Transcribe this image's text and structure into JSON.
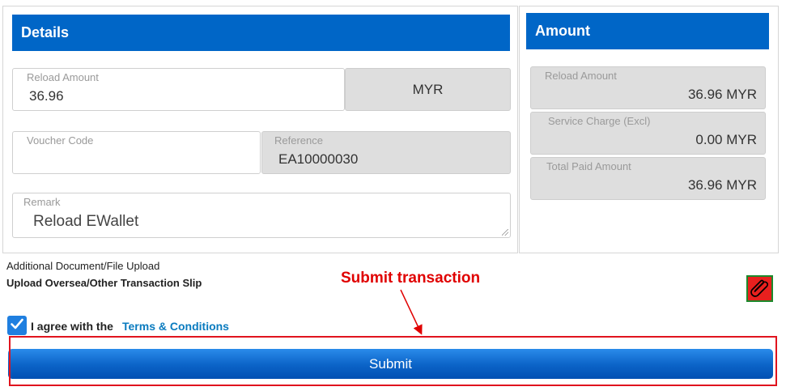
{
  "details": {
    "header": "Details",
    "reload_amount": {
      "label": "Reload Amount",
      "value": "36.96"
    },
    "currency": "MYR",
    "voucher_code": {
      "label": "Voucher Code",
      "value": ""
    },
    "reference": {
      "label": "Reference",
      "value": "EA10000030"
    },
    "remark": {
      "label": "Remark",
      "value": "Reload EWallet"
    }
  },
  "amount": {
    "header": "Amount",
    "rows": [
      {
        "label": "Reload Amount",
        "value": "36.96 MYR"
      },
      {
        "label": "Service Charge (Excl)",
        "value": "0.00 MYR"
      },
      {
        "label": "Total Paid Amount",
        "value": "36.96 MYR"
      }
    ]
  },
  "upload": {
    "caption": "Additional Document/File Upload",
    "title": "Upload Oversea/Other Transaction Slip",
    "icon": "paperclip-icon"
  },
  "agreement": {
    "checked": true,
    "text": "I agree with the",
    "link": "Terms & Conditions"
  },
  "submit_label": "Submit",
  "annotation": {
    "text": "Submit transaction",
    "color": "#e00000"
  },
  "colors": {
    "header_blue": "#0066c7",
    "link": "#0a7bbf",
    "submit_gradient_top": "#2a8bea",
    "submit_gradient_bottom": "#0050b3",
    "attach_bg": "#e8201e",
    "attach_border": "#1c8a2c"
  }
}
